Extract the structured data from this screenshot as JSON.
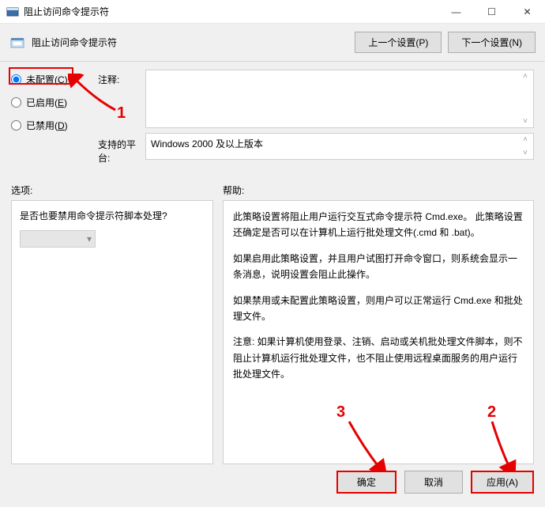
{
  "window": {
    "title": "阻止访问命令提示符",
    "minimize": "—",
    "maximize": "☐",
    "close": "✕"
  },
  "subheader": {
    "title": "阻止访问命令提示符",
    "prev": "上一个设置(P)",
    "next": "下一个设置(N)"
  },
  "config": {
    "radio_unconfigured_text": "未配置(",
    "radio_unconfigured_key": "C",
    "radio_unconfigured_close": ")",
    "radio_enabled_text": "已启用(",
    "radio_enabled_key": "E",
    "radio_enabled_close": ")",
    "radio_disabled_text": "已禁用(",
    "radio_disabled_key": "D",
    "radio_disabled_close": ")",
    "comment_label": "注释:",
    "comment_value": "",
    "platform_label": "支持的平台:",
    "platform_value": "Windows 2000 及以上版本"
  },
  "lower": {
    "options_label": "选项:",
    "help_label": "帮助:",
    "question": "是否也要禁用命令提示符脚本处理?",
    "dropdown_value": "",
    "help_paragraphs": [
      "此策略设置将阻止用户运行交互式命令提示符 Cmd.exe。 此策略设置还确定是否可以在计算机上运行批处理文件(.cmd 和 .bat)。",
      "如果启用此策略设置，并且用户试图打开命令窗口，则系统会显示一条消息，说明设置会阻止此操作。",
      "如果禁用或未配置此策略设置，则用户可以正常运行 Cmd.exe 和批处理文件。",
      "注意: 如果计算机使用登录、注销、启动或关机批处理文件脚本，则不阻止计算机运行批处理文件，也不阻止使用远程桌面服务的用户运行批处理文件。"
    ]
  },
  "buttons": {
    "ok": "确定",
    "cancel": "取消",
    "apply": "应用(A)"
  },
  "annotations": {
    "n1": "1",
    "n2": "2",
    "n3": "3"
  }
}
